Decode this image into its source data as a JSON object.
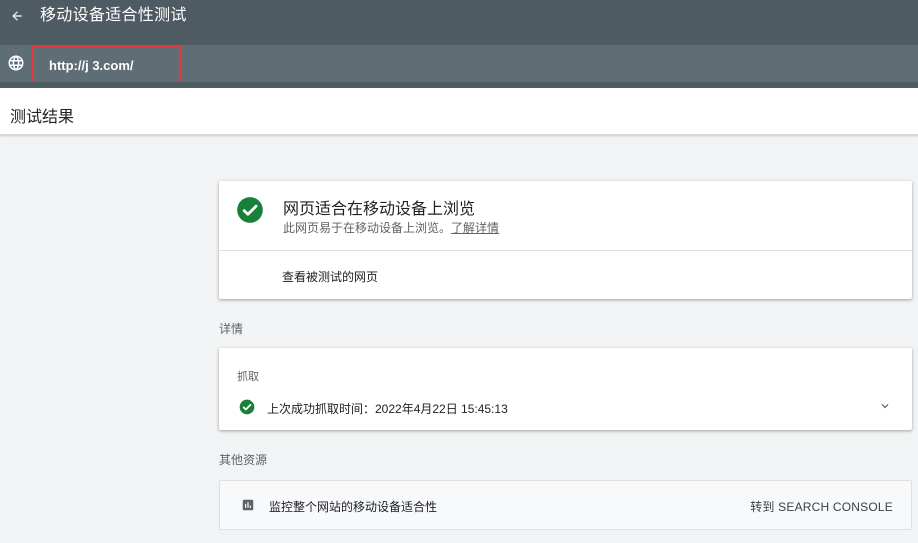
{
  "header": {
    "title": "移动设备适合性测试",
    "back_icon": "arrow-left-icon"
  },
  "urlbar": {
    "globe_icon": "globe-icon",
    "url": "http://j    3.com/"
  },
  "section": {
    "title": "测试结果"
  },
  "result": {
    "title": "网页适合在移动设备上浏览",
    "subtitle": "此网页易于在移动设备上浏览。",
    "learn_more": "了解详情",
    "view_tested_page": "查看被测试的网页",
    "status_color": "#188038"
  },
  "details": {
    "label": "详情",
    "crawl": {
      "label": "抓取",
      "last_success": "上次成功抓取时间：2022年4月22日 15:45:13"
    }
  },
  "other_resources": {
    "label": "其他资源",
    "item_text": "监控整个网站的移动设备适合性",
    "link_text": "转到 SEARCH CONSOLE",
    "icon": "bar-chart-icon"
  },
  "colors": {
    "topbar": "#4f5b62",
    "urlbar": "#5f6e75",
    "highlight_border": "#e53935",
    "background": "#f1f3f4"
  }
}
